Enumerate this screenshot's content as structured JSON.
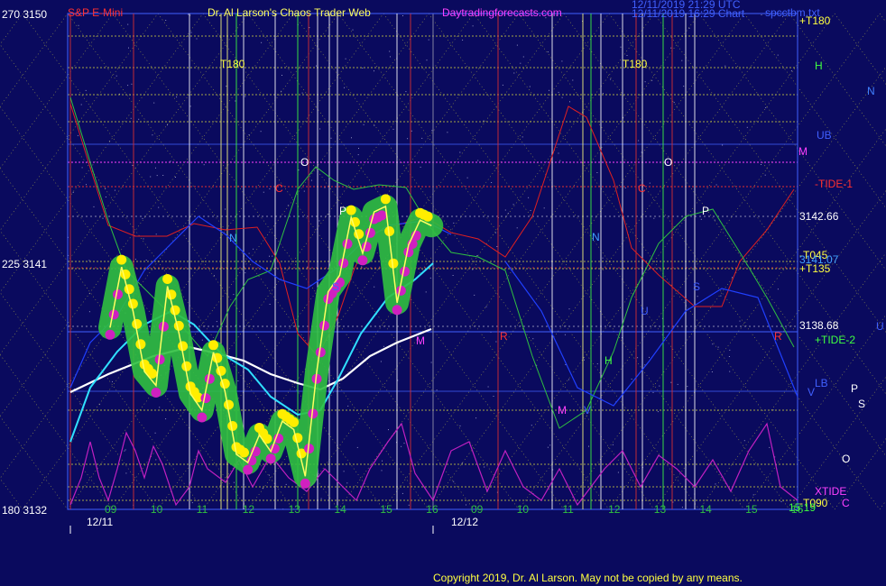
{
  "header": {
    "axis_top": "270  3150",
    "instrument": "S&P E-Mini",
    "title": "Dr. Al Larson's Chaos Trader Web",
    "site": "Daytradingforecasts.com",
    "timestamp_line1": "12/11/2019 21:29 UTC",
    "timestamp_line2": "12/11/2019 16:29 Chart",
    "file": "spcctbm.txt"
  },
  "left_axis": {
    "mid": "225  3141",
    "bottom": "180  3132"
  },
  "copyright": "Copyright 2019, Dr. Al Larson. May not be copied by any means.",
  "colors": {
    "background": "#0a0a5e",
    "yellow_grid": "#d8d840",
    "price": "#ffffff",
    "ma_cyan": "#30e0ff",
    "green_flow": "#30c040",
    "yellow_dot": "#ffee00",
    "magenta_dot": "#d020c0",
    "red_line": "#e02020",
    "blue_line": "#2040ff",
    "tide": "#c020c0"
  },
  "right_labels": {
    "t180": "+T180",
    "h": "H",
    "n": "N",
    "ub": "UB",
    "m": "M",
    "tide1": "-TIDE-1",
    "p3142": "3142.66",
    "t045": "-T045",
    "p3141": "3141.07",
    "t135": "+T135",
    "p3138": "3138.68",
    "u": "U",
    "tide2": "+TIDE-2",
    "lb": "LB",
    "v": "V",
    "p": "P",
    "s": "S",
    "o": "O",
    "xtide": "XTIDE",
    "t090": "-T090",
    "c": "C",
    "cbottom": "C",
    "ebottom": "15:19"
  },
  "inner_labels": {
    "t180a": "T180",
    "t180b": "T180",
    "o1": "O",
    "c1": "C",
    "n1": "N",
    "p1": "P",
    "s1": "S",
    "n2": "N",
    "o2": "O",
    "c2": "C",
    "p2": "P",
    "s2": "S",
    "r1": "R",
    "r2": "R",
    "u1": "U",
    "h1": "H",
    "m1": "M",
    "v1": "V",
    "m2": "M"
  },
  "chart_data": {
    "type": "line",
    "instrument": "S&P E-Mini",
    "y_ticks": [
      "3150",
      "3141",
      "3132"
    ],
    "y_ticks_alt": [
      "270",
      "225",
      "180"
    ],
    "ylim": [
      3132,
      3150
    ],
    "x_ticks_day1": [
      "09",
      "10",
      "11",
      "12",
      "13",
      "14",
      "15",
      "16"
    ],
    "x_ticks_day2": [
      "09",
      "10",
      "11",
      "12",
      "13",
      "14",
      "15",
      "16"
    ],
    "dates": [
      "12/11",
      "12/12"
    ],
    "series": [
      {
        "name": "price",
        "x": [
          9.0,
          9.25,
          9.5,
          9.75,
          10.0,
          10.25,
          10.5,
          10.75,
          11.0,
          11.25,
          11.5,
          11.75,
          12.0,
          12.25,
          12.5,
          12.75,
          13.0,
          13.25,
          13.5,
          13.75,
          14.0,
          14.25,
          14.5,
          14.75,
          15.0,
          15.25,
          15.5,
          15.75,
          16.0
        ],
        "values": [
          3138.6,
          3140.8,
          3139.2,
          3137.0,
          3136.5,
          3140.1,
          3138.4,
          3136.2,
          3135.6,
          3137.7,
          3136.3,
          3134.0,
          3133.7,
          3134.7,
          3134.1,
          3135.2,
          3134.9,
          3133.2,
          3137.0,
          3139.9,
          3140.5,
          3142.6,
          3141.3,
          3142.8,
          3143.0,
          3139.5,
          3141.6,
          3142.5,
          3142.3
        ]
      },
      {
        "name": "price_forecast_levels",
        "values": [
          3142.66,
          3141.07,
          3138.68
        ]
      }
    ]
  }
}
